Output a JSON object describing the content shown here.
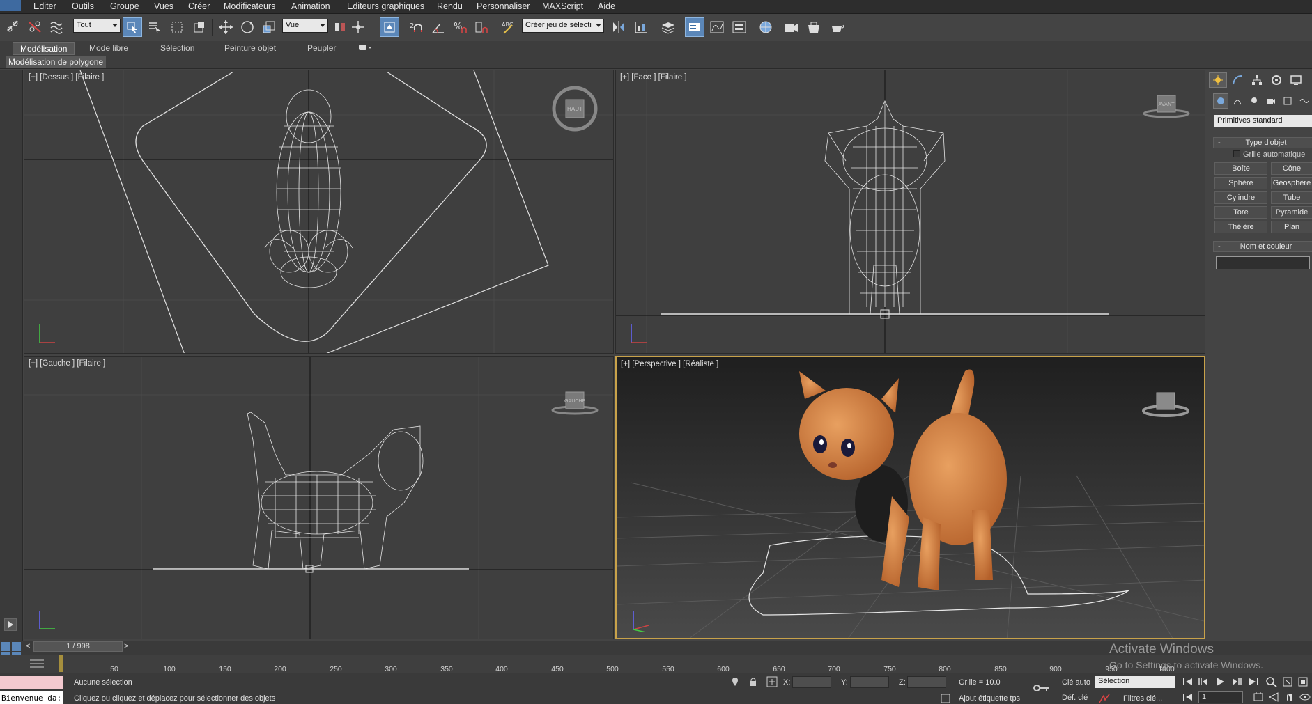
{
  "menu": {
    "items": [
      "Editer",
      "Outils",
      "Groupe",
      "Vues",
      "Créer",
      "Modificateurs",
      "Animation",
      "Editeurs graphiques",
      "Rendu",
      "Personnaliser",
      "MAXScript",
      "Aide"
    ]
  },
  "toolbar": {
    "selection_filter": "Tout",
    "reference_coord": "Vue",
    "named_selection_placeholder": "Créer jeu de sélecti"
  },
  "ribbon": {
    "tabs": [
      "Modélisation",
      "Mode libre",
      "Sélection",
      "Peinture objet",
      "Peupler"
    ],
    "active_tab": "Modélisation",
    "panel_label": "Modélisation de polygone"
  },
  "viewports": {
    "top": {
      "label": "[+] [Dessus ] [Filaire ]",
      "cube_label": "HAUT"
    },
    "front": {
      "label": "[+] [Face ] [Filaire ]",
      "cube_label": "AVANT"
    },
    "left": {
      "label": "[+] [Gauche ] [Filaire ]",
      "cube_label": "GAUCHE"
    },
    "perspective": {
      "label": "[+] [Perspective ] [Réaliste ]"
    }
  },
  "command_panel": {
    "category": "Primitives standard",
    "object_type_title": "Type d'objet",
    "autogrid_label": "Grille automatique",
    "buttons": [
      "Boîte",
      "Cône",
      "Sphère",
      "Géosphère",
      "Cylindre",
      "Tube",
      "Tore",
      "Pyramide",
      "Théière",
      "Plan"
    ],
    "name_color_title": "Nom et couleur"
  },
  "timeline": {
    "frame_display": "1 / 998",
    "ticks": [
      "50",
      "100",
      "150",
      "200",
      "250",
      "300",
      "350",
      "400",
      "450",
      "500",
      "550",
      "600",
      "650",
      "700",
      "750",
      "800",
      "850",
      "900",
      "950",
      "1000"
    ]
  },
  "status": {
    "maxscript_text": "Bienvenue da:",
    "selection_status": "Aucune sélection",
    "prompt": "Cliquez ou cliquez et déplacez pour sélectionner des objets",
    "x_label": "X:",
    "y_label": "Y:",
    "z_label": "Z:",
    "grid": "Grille = 10.0",
    "add_time_tag": "Ajout étiquette tps",
    "auto_key": "Clé auto",
    "set_key": "Déf. clé",
    "key_filter_dropdown": "Sélection",
    "key_filters": "Filtres clé...",
    "frame_field": "1"
  },
  "watermark": {
    "line1": "Activate Windows",
    "line2": "Go to Settings to activate Windows."
  },
  "colors": {
    "accent_active_viewport": "#c8a24a",
    "active_button": "#5b87b9"
  }
}
